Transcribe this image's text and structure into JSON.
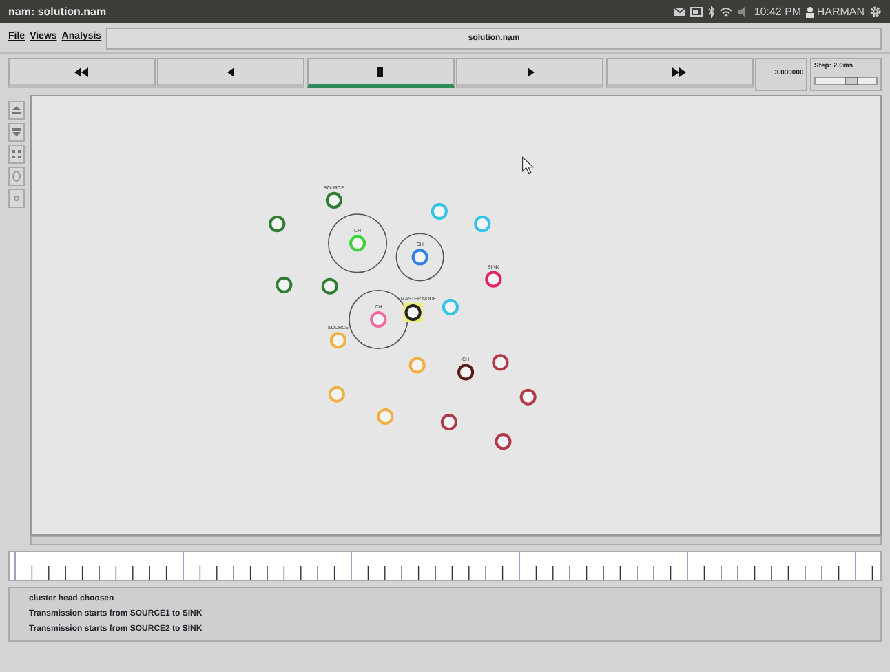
{
  "window": {
    "title": "nam: solution.nam"
  },
  "tray": {
    "time": "10:42 PM",
    "user": "HARMAN"
  },
  "menu": [
    {
      "label": "File"
    },
    {
      "label": "Views"
    },
    {
      "label": "Analysis"
    }
  ],
  "file_field": {
    "value": "solution.nam"
  },
  "controls": [
    {
      "kind": "rewind",
      "selected": false
    },
    {
      "kind": "back",
      "selected": false
    },
    {
      "kind": "stop",
      "selected": true
    },
    {
      "kind": "play",
      "selected": false
    },
    {
      "kind": "forward",
      "selected": false
    }
  ],
  "sim_time": "3.030000",
  "step": {
    "label": "Step: 2.0ms",
    "level": 0.6
  },
  "nodes": [
    {
      "kind": "plain",
      "color": "#2e7d32",
      "label": "SOURCE"
    },
    {
      "kind": "plain",
      "color": "#2e7d32"
    },
    {
      "kind": "ringed",
      "color": "#39d33c",
      "label": "CH"
    },
    {
      "kind": "plain",
      "color": "#33c3e6"
    },
    {
      "kind": "plain",
      "color": "#33c3e6"
    },
    {
      "kind": "ringed",
      "color": "#2f7ee8",
      "label": "CH"
    },
    {
      "kind": "plain",
      "color": "#e8205f",
      "label": "SINK"
    },
    {
      "kind": "plain",
      "color": "#2e7d32"
    },
    {
      "kind": "plain",
      "color": "#2e7d32"
    },
    {
      "kind": "ringed",
      "color": "#f06aa0",
      "label": "CH"
    },
    {
      "kind": "highlighted",
      "color": "#222222",
      "label": "MASTER NODE"
    },
    {
      "kind": "plain",
      "color": "#33c3e6"
    },
    {
      "kind": "plain",
      "color": "#f0b040",
      "label": "SOURCE"
    },
    {
      "kind": "plain",
      "color": "#f0b040"
    },
    {
      "kind": "plain",
      "color": "#5a1a1a",
      "label": "CH"
    },
    {
      "kind": "plain",
      "color": "#b03a48"
    },
    {
      "kind": "plain",
      "color": "#f0b040"
    },
    {
      "kind": "plain",
      "color": "#f0b040"
    },
    {
      "kind": "plain",
      "color": "#b03a48"
    },
    {
      "kind": "plain",
      "color": "#b03a48"
    },
    {
      "kind": "plain",
      "color": "#b03a48"
    }
  ],
  "log": [
    "cluster head choosen",
    "Transmission starts from SOURCE1 to SINK",
    "Transmission starts from SOURCE2 to SINK"
  ]
}
